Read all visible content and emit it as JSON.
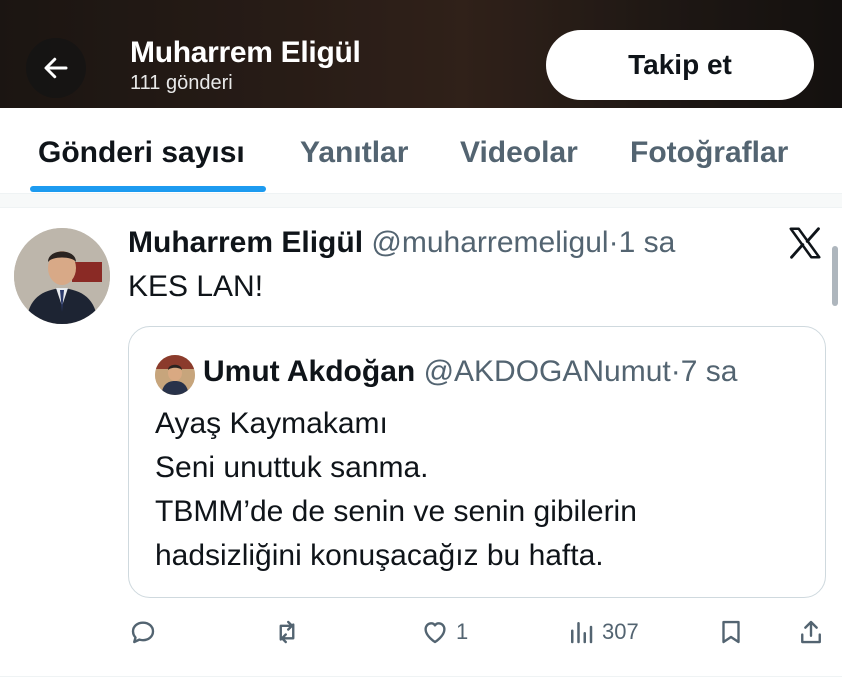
{
  "header": {
    "profile_name": "Muharrem Eligül",
    "post_count": "111 gönderi",
    "follow_label": "Takip et",
    "back_icon": "arrow-left-icon"
  },
  "tabs": [
    {
      "label": "Gönderi sayısı",
      "active": true
    },
    {
      "label": "Yanıtlar",
      "active": false
    },
    {
      "label": "Videolar",
      "active": false
    },
    {
      "label": "Fotoğraflar",
      "active": false
    }
  ],
  "tweet": {
    "name": "Muharrem Eligül",
    "handle": "@muharremeligul",
    "separator": "·",
    "time": "1 sa",
    "text": "KES LAN!",
    "source_icon": "x-logo-icon"
  },
  "quote": {
    "name": "Umut Akdoğan",
    "handle": "@AKDOGANumut",
    "separator": "·",
    "time": "7 sa",
    "lines": [
      "Ayaş Kaymakamı",
      "Seni unuttuk sanma.",
      "TBMM’de de senin ve senin gibilerin",
      "hadsizliğini konuşacağız bu hafta."
    ]
  },
  "actions": {
    "reply_icon": "reply-icon",
    "retweet_icon": "retweet-icon",
    "like_icon": "heart-icon",
    "like_count": "1",
    "views_icon": "views-chart-icon",
    "views_count": "307",
    "bookmark_icon": "bookmark-icon",
    "share_icon": "share-icon"
  },
  "colors": {
    "accent": "#1d9bf0",
    "text_primary": "#0f1419",
    "text_secondary": "#536471",
    "border": "#cfd9de"
  }
}
